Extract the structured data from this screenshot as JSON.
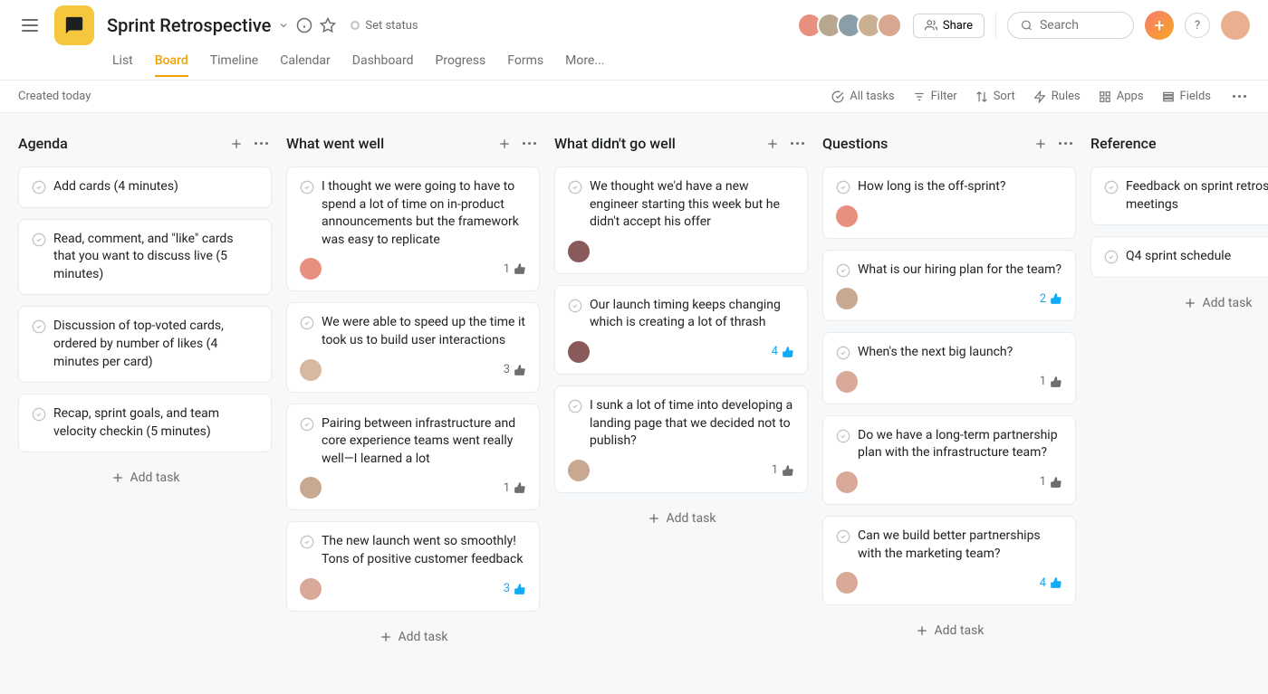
{
  "project": {
    "title": "Sprint Retrospective",
    "set_status": "Set status"
  },
  "tabs": [
    "List",
    "Board",
    "Timeline",
    "Calendar",
    "Dashboard",
    "Progress",
    "Forms",
    "More..."
  ],
  "active_tab": 1,
  "subheader": {
    "created": "Created today"
  },
  "toolbar": {
    "all_tasks": "All tasks",
    "filter": "Filter",
    "sort": "Sort",
    "rules": "Rules",
    "apps": "Apps",
    "fields": "Fields"
  },
  "share_label": "Share",
  "search_placeholder": "Search",
  "add_task_label": "Add task",
  "header_avatars": [
    "#e89080",
    "#b8a890",
    "#8a9ea8",
    "#c8b090",
    "#d8a890"
  ],
  "profile_color": "#e8b090",
  "columns": [
    {
      "title": "Agenda",
      "cards": [
        {
          "text": "Add cards (4 minutes)"
        },
        {
          "text": "Read, comment, and \"like\" cards that you want to discuss live (5 minutes)"
        },
        {
          "text": "Discussion of top-voted cards, ordered by number of likes (4 minutes per card)"
        },
        {
          "text": "Recap, sprint goals, and team velocity checkin (5 minutes)"
        }
      ]
    },
    {
      "title": "What went well",
      "cards": [
        {
          "text": "I thought we were going to have to spend a lot of time on in-product announcements but the framework was easy to replicate",
          "assignee": "#e89080",
          "likes": "1",
          "likes_active": false
        },
        {
          "text": "We were able to speed up the time it took us to build user interactions",
          "assignee": "#d8b8a0",
          "likes": "3",
          "likes_active": false
        },
        {
          "text": "Pairing between infrastructure and core experience teams went really well—I learned a lot",
          "assignee": "#c8a890",
          "likes": "1",
          "likes_active": false
        },
        {
          "text": "The new launch went so smoothly! Tons of positive customer feedback",
          "assignee": "#d8a898",
          "likes": "3",
          "likes_active": true
        }
      ]
    },
    {
      "title": "What didn't go well",
      "cards": [
        {
          "text": "We thought we'd have a new engineer starting this week but he didn't accept his offer",
          "assignee": "#8a5a5a"
        },
        {
          "text": "Our launch timing keeps changing which is creating a lot of thrash",
          "assignee": "#8a5a5a",
          "likes": "4",
          "likes_active": true
        },
        {
          "text": "I sunk a lot of time into developing a landing page that we decided not to publish?",
          "assignee": "#c8a890",
          "likes": "1",
          "likes_active": false
        }
      ]
    },
    {
      "title": "Questions",
      "cards": [
        {
          "text": "How long is the off-sprint?",
          "assignee": "#e89080"
        },
        {
          "text": "What is our hiring plan for the team?",
          "assignee": "#c8a890",
          "likes": "2",
          "likes_active": true
        },
        {
          "text": "When's the next big launch?",
          "assignee": "#d8a898",
          "likes": "1",
          "likes_active": false
        },
        {
          "text": "Do we have a long-term partnership plan with the infrastructure team?",
          "assignee": "#d8a898",
          "likes": "1",
          "likes_active": false
        },
        {
          "text": "Can we build better partnerships with the marketing team?",
          "assignee": "#d8a898",
          "likes": "4",
          "likes_active": true
        }
      ]
    },
    {
      "title": "Reference",
      "cards": [
        {
          "text": "Feedback on sprint retrosp meetings"
        },
        {
          "text": "Q4 sprint schedule"
        }
      ]
    }
  ]
}
